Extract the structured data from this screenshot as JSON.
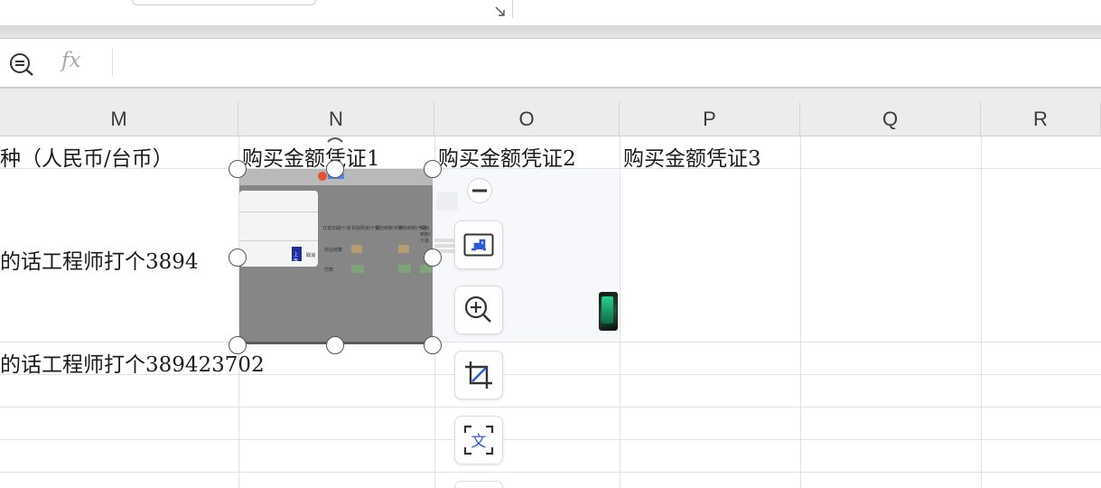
{
  "formula_bar": {
    "fx_label": "fx",
    "value": ""
  },
  "columns": [
    "M",
    "N",
    "O",
    "P",
    "Q",
    "R"
  ],
  "cells": {
    "m1": "种（人民币/台币）",
    "n1": "购买金额凭证1",
    "o1": "购买金额凭证2",
    "p1": "购买金额凭证3",
    "m2": "的话工程师打个3894",
    "m3": "的话工程师打个389423702"
  },
  "embedded_picture": {
    "button_text": "上传",
    "cancel_text": "取消",
    "col_a": "订单日期/十进",
    "col_b": "实际购买/十进",
    "col_c": "实际到账/币种",
    "col_d": "实际到账/十进",
    "col_e": "实际到账/十进",
    "row1_a": "商业结算",
    "row2_a": "付款"
  },
  "toolbar": {
    "tools": [
      "collapse",
      "image-edit",
      "zoom-in",
      "crop",
      "ocr"
    ]
  },
  "colors": {
    "header_bg": "#ececec",
    "accent": "#2f5bd6",
    "picture_bg": "#868686"
  }
}
